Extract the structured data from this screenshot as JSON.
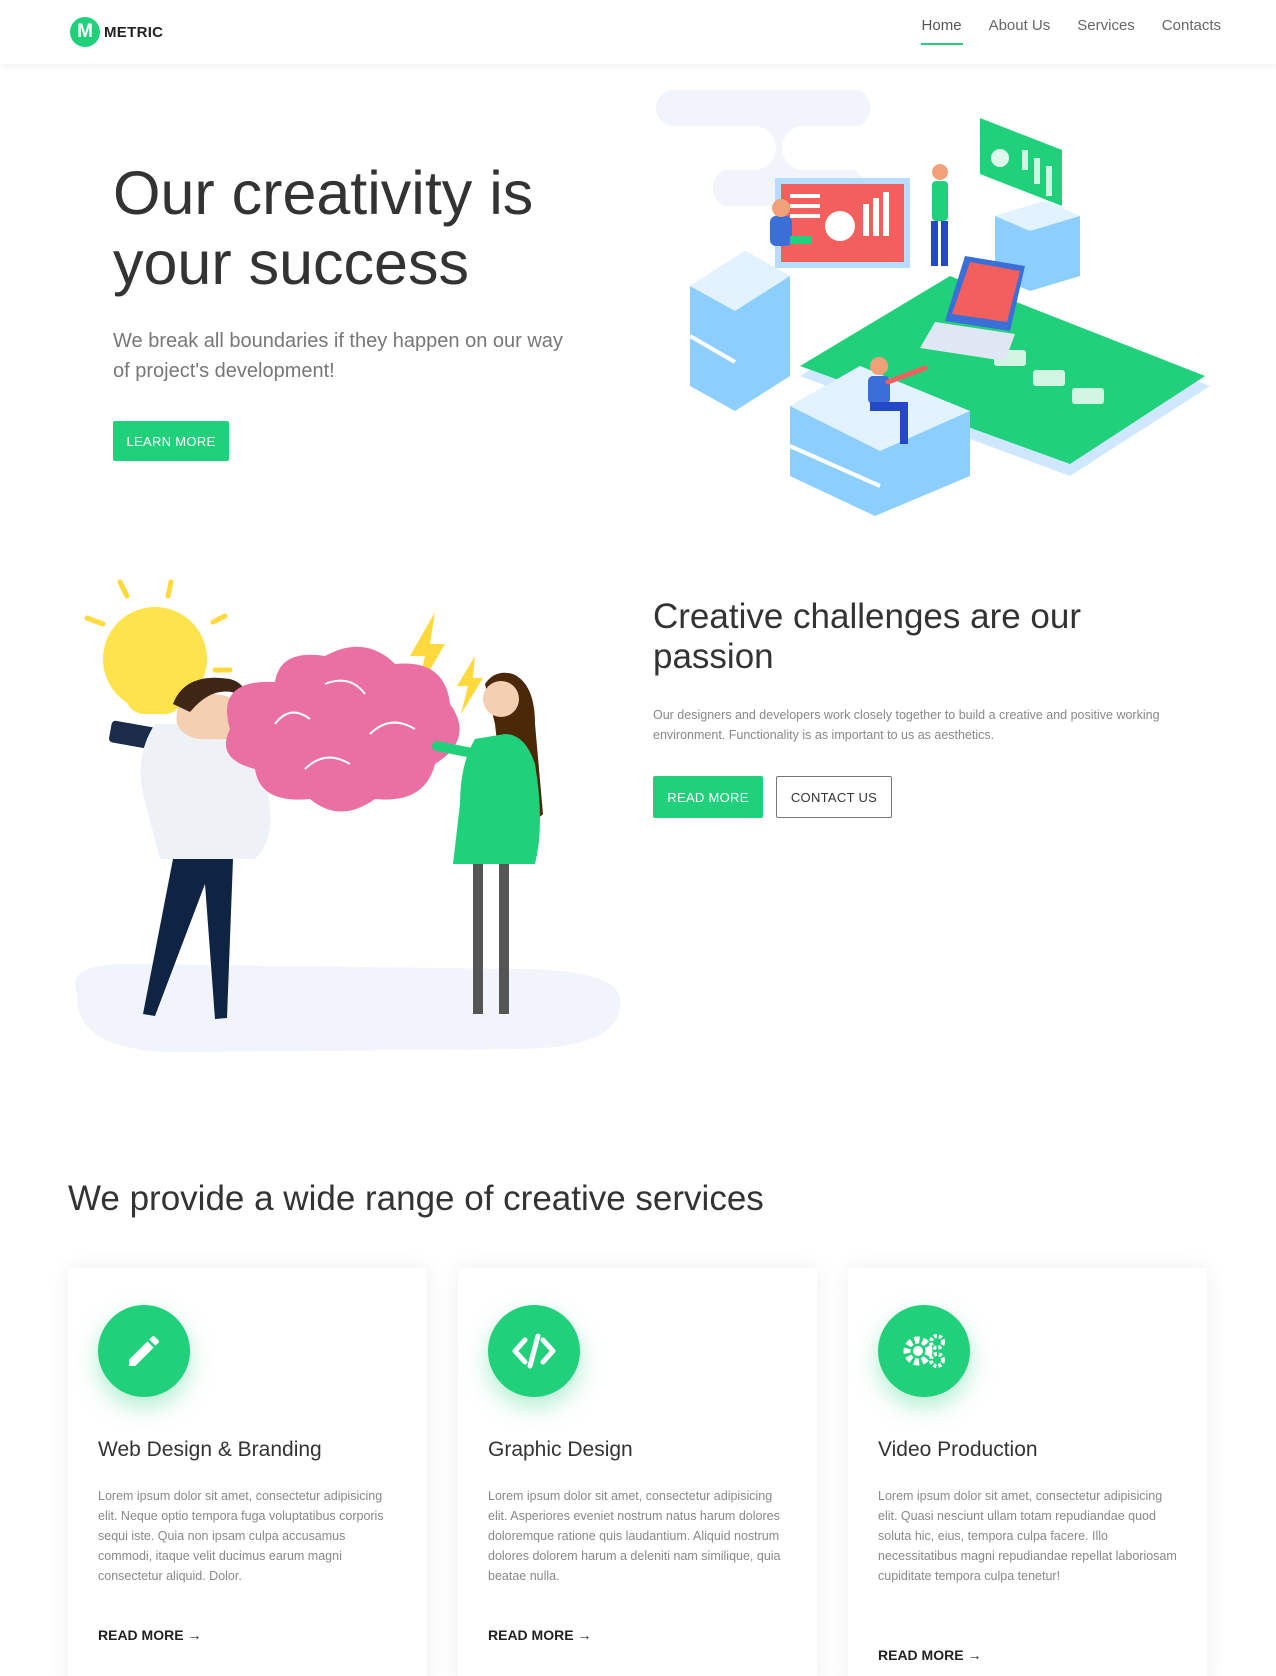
{
  "brand": {
    "mark": "M",
    "name": "METRIC",
    "accent_color": "#21d07a"
  },
  "nav": {
    "items": [
      {
        "label": "Home",
        "active": true
      },
      {
        "label": "About Us",
        "active": false
      },
      {
        "label": "Services",
        "active": false
      },
      {
        "label": "Contacts",
        "active": false
      }
    ]
  },
  "hero": {
    "title": "Our creativity is your success",
    "subtitle": "We break all boundaries if they happen on our way of project's development!",
    "button": "LEARN MORE"
  },
  "challenges": {
    "title": "Creative challenges are our passion",
    "text": "Our designers and developers work closely together to build a creative and positive working environment. Functionality is as important to us as aesthetics.",
    "primary_button": "READ MORE",
    "secondary_button": "CONTACT US"
  },
  "services": {
    "title": "We provide a wide range of creative services",
    "cards": [
      {
        "icon": "pencil-icon",
        "title": "Web Design & Branding",
        "text": "Lorem ipsum dolor sit amet, consectetur adipisicing elit. Neque optio tempora fuga voluptatibus corporis sequi iste. Quia non ipsam culpa accusamus commodi, itaque velit ducimus earum magni consectetur aliquid. Dolor.",
        "link": "READ MORE →"
      },
      {
        "icon": "code-icon",
        "title": "Graphic Design",
        "text": "Lorem ipsum dolor sit amet, consectetur adipisicing elit. Asperiores eveniet nostrum natus harum dolores doloremque ratione quis laudantium. Aliquid nostrum dolores dolorem harum a deleniti nam similique, quia beatae nulla.",
        "link": "READ MORE →"
      },
      {
        "icon": "gears-icon",
        "title": "Video Production",
        "text": "Lorem ipsum dolor sit amet, consectetur adipisicing elit. Quasi nesciunt ullam totam repudiandae quod soluta hic, eius, tempora culpa facere. Illo necessitatibus magni repudiandae repellat laboriosam cupiditate tempora culpa tenetur!",
        "link": "READ MORE →"
      }
    ]
  }
}
